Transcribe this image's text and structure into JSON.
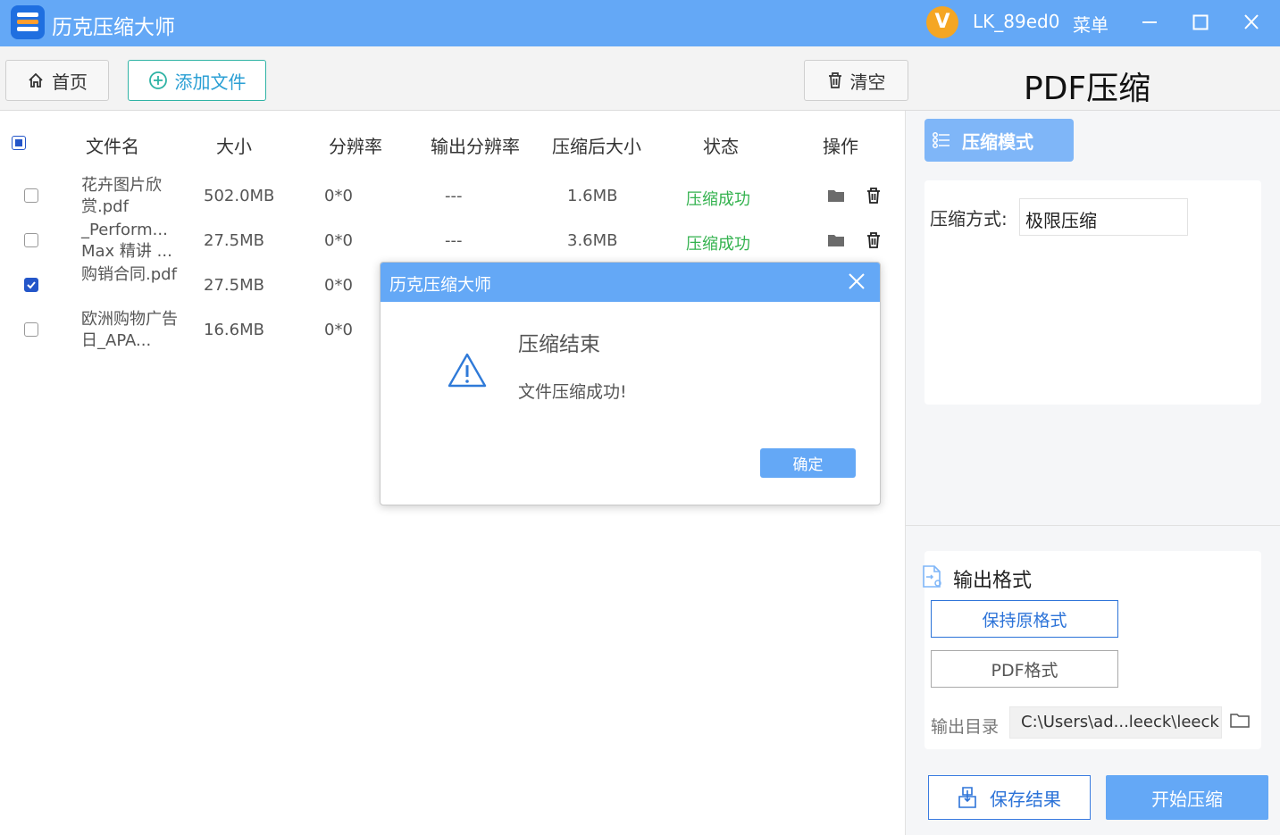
{
  "app": {
    "title": "历克压缩大师",
    "user_initial": "V",
    "username": "LK_89ed0",
    "menu": "菜单"
  },
  "toolbar": {
    "home": "首页",
    "add_file": "添加文件",
    "clear": "清空",
    "page_title": "PDF压缩"
  },
  "table": {
    "headers": [
      "文件名",
      "大小",
      "分辨率",
      "输出分辨率",
      "压缩后大小",
      "状态",
      "操作"
    ],
    "rows": [
      {
        "name": "花卉图片欣赏.pdf",
        "size": "502.0MB",
        "resolution": "0*0",
        "out_resolution": "---",
        "compressed": "1.6MB",
        "status": "压缩成功",
        "checked": false
      },
      {
        "name": "_Perform... Max 精讲 ...",
        "size": "27.5MB",
        "resolution": "0*0",
        "out_resolution": "---",
        "compressed": "3.6MB",
        "status": "压缩成功",
        "checked": false
      },
      {
        "name": "购销合同.pdf",
        "size": "27.5MB",
        "resolution": "0*0",
        "checked": true
      },
      {
        "name": "欧洲购物广告日_APA...",
        "size": "16.6MB",
        "resolution": "0*0",
        "checked": false
      }
    ]
  },
  "settings": {
    "mode_tab": "压缩模式",
    "method_label": "压缩方式:",
    "method_value": "极限压缩",
    "output_title": "输出格式",
    "keep_format": "保持原格式",
    "pdf_format": "PDF格式",
    "dir_label": "输出目录",
    "dir_value": "C:\\Users\\ad...leeck\\leeck",
    "save_result": "保存结果",
    "start": "开始压缩"
  },
  "dialog": {
    "title": "历克压缩大师",
    "heading": "压缩结束",
    "message": "文件压缩成功!",
    "ok": "确定"
  },
  "colors": {
    "primary": "#64a8f6",
    "success": "#33b24e",
    "accent": "#2c73d8"
  }
}
